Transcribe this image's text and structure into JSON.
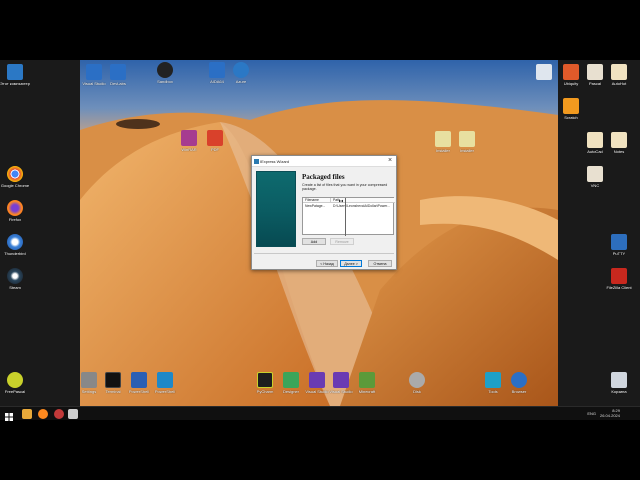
{
  "desktop": {
    "left_icons": [
      {
        "label": "Этот компьютер",
        "name": "this-pc",
        "color": "#2b78c5"
      },
      {
        "label": "Google Chrome",
        "name": "chrome",
        "color": "#e14b3b"
      },
      {
        "label": "Firefox",
        "name": "firefox",
        "color": "#ff8a1f"
      },
      {
        "label": "Thunderbird",
        "name": "thunderbird",
        "color": "#3c82d8"
      },
      {
        "label": "Steam",
        "name": "steam",
        "color": "#2a475e"
      },
      {
        "label": "FreePascal",
        "name": "freepascal",
        "color": "#c9d12b"
      }
    ],
    "top_icons": [
      {
        "label": "Visual Studio",
        "name": "app-1",
        "color": "#2b6fc5"
      },
      {
        "label": "DevLabs",
        "name": "app-2",
        "color": "#2b6fc5"
      },
      {
        "label": "Sandbox",
        "name": "app-3",
        "color": "#222"
      },
      {
        "label": "AIDA64",
        "name": "app-4",
        "color": "#2b6fc5"
      },
      {
        "label": "Azure",
        "name": "app-5",
        "color": "#2b78c5"
      },
      {
        "label": "WinRAR",
        "name": "app-6",
        "color": "#a63c90"
      },
      {
        "label": "PDF",
        "name": "app-7",
        "color": "#d9412b"
      }
    ],
    "middle_icons": [
      {
        "label": "Installer",
        "name": "app-8",
        "color": "#e8e0a0"
      },
      {
        "label": "Installer",
        "name": "app-9",
        "color": "#e8e0a0"
      }
    ],
    "right_icons": [
      {
        "label": "Ubiquity",
        "name": "r1",
        "color": "#e05a2a"
      },
      {
        "label": "Pascal",
        "name": "r2",
        "color": "#e8e0d0"
      },
      {
        "label": "AutoHot",
        "name": "r3",
        "color": "#f0e2c0"
      },
      {
        "label": "Scratch",
        "name": "r4",
        "color": "#f29a1f"
      },
      {
        "label": "AutoCad",
        "name": "r5",
        "color": "#f0e2c0"
      },
      {
        "label": "Notes",
        "name": "r6",
        "color": "#f0e2c0"
      },
      {
        "label": "VNC",
        "name": "r7",
        "color": "#e8e0d0"
      },
      {
        "label": "PuTTY",
        "name": "r8",
        "color": "#2d6ebd"
      },
      {
        "label": "FileZilla Client",
        "name": "r9",
        "color": "#c8281e"
      },
      {
        "label": "Корзина",
        "name": "r10",
        "color": "#d0d6de"
      }
    ],
    "bottom_icons": [
      {
        "label": "Settings",
        "name": "b1",
        "color": "#888"
      },
      {
        "label": "Terminal",
        "name": "b2",
        "color": "#111"
      },
      {
        "label": "PowerShell",
        "name": "b3",
        "color": "#2b5fb3"
      },
      {
        "label": "PowerShell",
        "name": "b4",
        "color": "#1e88c8"
      },
      {
        "label": "PyCharm",
        "name": "b5",
        "color": "#1e1e1e"
      },
      {
        "label": "Designer",
        "name": "b6",
        "color": "#3aa55a"
      },
      {
        "label": "Visual Studio",
        "name": "b7",
        "color": "#6a3bb3"
      },
      {
        "label": "Visual Studio",
        "name": "b8",
        "color": "#6a3bb3"
      },
      {
        "label": "Minecraft",
        "name": "b9",
        "color": "#5c9a3a"
      },
      {
        "label": "Disk",
        "name": "b10",
        "color": "#aaa"
      },
      {
        "label": "Tools",
        "name": "b11",
        "color": "#1ea0c8"
      },
      {
        "label": "Browser",
        "name": "b12",
        "color": "#2b6fc5"
      }
    ]
  },
  "taskbar": {
    "lang": "ENG",
    "time": "8:29",
    "date": "26.04.2024"
  },
  "dialog": {
    "title": "IExpress Wizard",
    "heading": "Packaged files",
    "description": "Create a list of files that you want in your compressed package.",
    "table": {
      "col_name": "Filename",
      "col_path": "Path",
      "row_name": "NewPatage...",
      "row_path": "D:\\Users\\Leonsheva\\AIDollar\\Power..."
    },
    "buttons": {
      "add": "Add",
      "remove": "Remove",
      "back": "< Назад",
      "next": "Далее >",
      "cancel": "Отмена"
    }
  }
}
